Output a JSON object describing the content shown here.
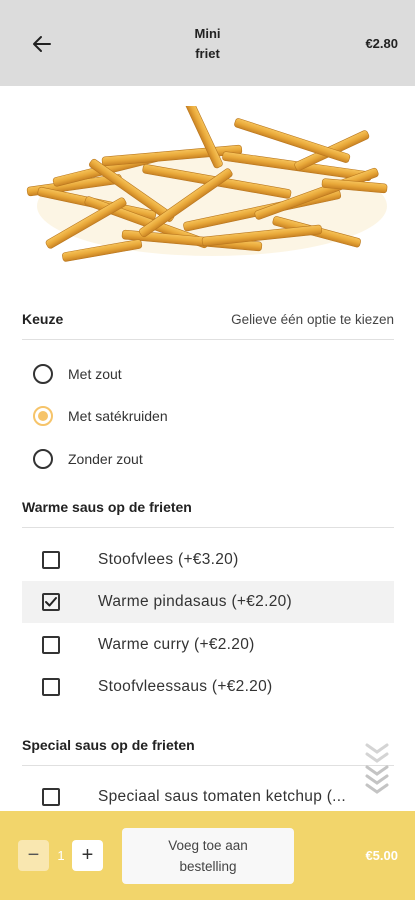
{
  "header": {
    "title_line1": "Mini",
    "title_line2": "friet",
    "price": "€2.80"
  },
  "product_image": {
    "alt": "fries-photo"
  },
  "keuze": {
    "title": "Keuze",
    "hint": "Gelieve één optie te kiezen",
    "options": [
      {
        "label": "Met zout",
        "selected": false
      },
      {
        "label": "Met satékruiden",
        "selected": true
      },
      {
        "label": "Zonder zout",
        "selected": false
      }
    ]
  },
  "warme_saus": {
    "title": "Warme saus op de frieten",
    "options": [
      {
        "label": "Stoofvlees (+€3.20)",
        "checked": false
      },
      {
        "label": "Warme pindasaus (+€2.20)",
        "checked": true
      },
      {
        "label": "Warme curry (+€2.20)",
        "checked": false
      },
      {
        "label": "Stoofvleessaus (+€2.20)",
        "checked": false
      }
    ]
  },
  "special_saus": {
    "title": "Special saus op de frieten",
    "options": [
      {
        "label": "Speciaal saus tomaten ketchup (...",
        "checked": false
      }
    ]
  },
  "bottom_bar": {
    "minus": "−",
    "quantity": "1",
    "plus": "+",
    "add_line1": "Voeg toe aan",
    "add_line2": "bestelling",
    "total": "€5.00"
  },
  "colors": {
    "accent": "#f6c46a",
    "bottom_bar": "#f2d56b",
    "header_bg": "#dcdcdc"
  }
}
